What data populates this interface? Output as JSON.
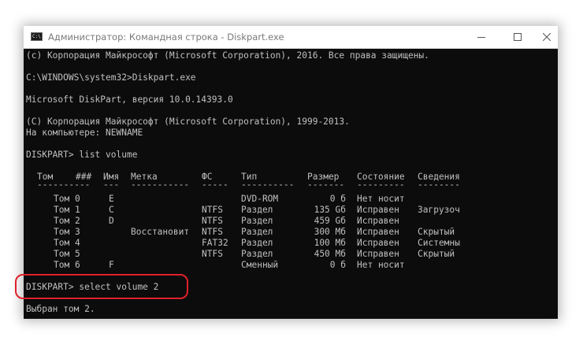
{
  "window": {
    "title": "Администратор: Командная строка - Diskpart.exe",
    "icon_text": "C:\\"
  },
  "console": {
    "lines": [
      "(c) Корпорация Майкрософт (Microsoft Corporation), 2016. Все права защищены.",
      "",
      "C:\\WINDOWS\\system32>Diskpart.exe",
      "",
      "Microsoft DiskPart, версия 10.0.14393.0",
      "",
      "(C) Корпорация Майкрософт (Microsoft Corporation), 1999-2013.",
      "На компьютере: NEWNAME",
      "",
      "DISKPART> list volume"
    ],
    "table": {
      "headers": [
        "Том",
        "###",
        "Имя",
        "Метка",
        "ФС",
        "Тип",
        "Размер",
        "Состояние",
        "Сведения"
      ],
      "separators": [
        "----------",
        "---",
        "-----------",
        "-----",
        "----------",
        "-------",
        "---------",
        "--------"
      ],
      "rows": [
        [
          "Том 0",
          "E",
          "",
          "",
          "DVD-ROM",
          "0 б",
          "Нет носит",
          ""
        ],
        [
          "Том 1",
          "C",
          "",
          "NTFS",
          "Раздел",
          "135 Gб",
          "Исправен",
          "Загрузоч"
        ],
        [
          "Том 2",
          "D",
          "",
          "NTFS",
          "Раздел",
          "459 Gб",
          "Исправен",
          ""
        ],
        [
          "Том 3",
          "",
          "Восстановит",
          "NTFS",
          "Раздел",
          "300 Mб",
          "Исправен",
          "Скрытый"
        ],
        [
          "Том 4",
          "",
          "",
          "FAT32",
          "Раздел",
          "100 Mб",
          "Исправен",
          "Системны"
        ],
        [
          "Том 5",
          "",
          "",
          "NTFS",
          "Раздел",
          "450 Mб",
          "Исправен",
          "Скрытый"
        ],
        [
          "Том 6",
          "F",
          "",
          "",
          "Сменный",
          "0 б",
          "Нет носит",
          ""
        ]
      ]
    },
    "command": "DISKPART> select volume 2",
    "result": "Выбран том 2."
  }
}
